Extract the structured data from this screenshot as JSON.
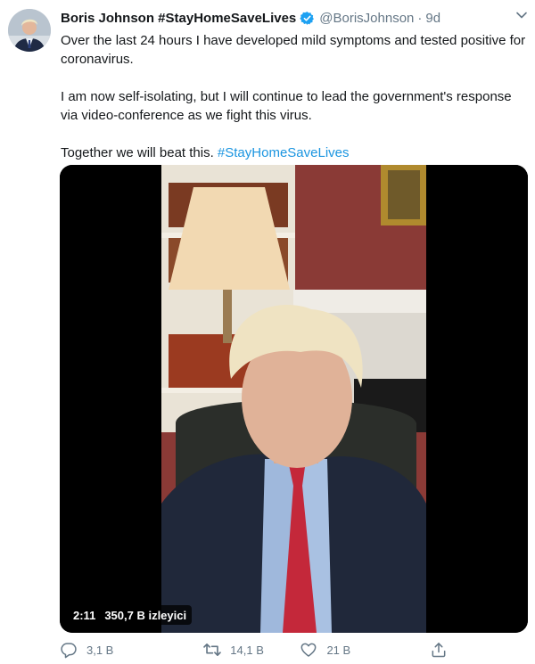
{
  "tweet": {
    "author": {
      "name": "Boris Johnson #StayHomeSaveLives",
      "handle": "@BorisJohnson",
      "separator": "·",
      "time": "9d",
      "avatar_icon": "profile-photo",
      "verified_icon": "verified-badge-icon"
    },
    "text": {
      "paragraph1": "Over the last 24 hours I have developed mild symptoms and tested positive for coronavirus.",
      "paragraph2": "I am now self-isolating, but I will continue to lead the government's response via video-conference as we fight this virus.",
      "paragraph3_prefix": "Together we will beat this. ",
      "hashtag": "#StayHomeSaveLives"
    },
    "media": {
      "duration": "2:11",
      "views": "350,7 B izleyici"
    },
    "actions": {
      "reply_count": "3,1 B",
      "retweet_count": "14,1 B",
      "like_count": "21 B"
    },
    "colors": {
      "accent": "#1b95e0",
      "verified": "#1da1f2",
      "secondary_text": "#657786",
      "primary_text": "#14171a"
    }
  }
}
